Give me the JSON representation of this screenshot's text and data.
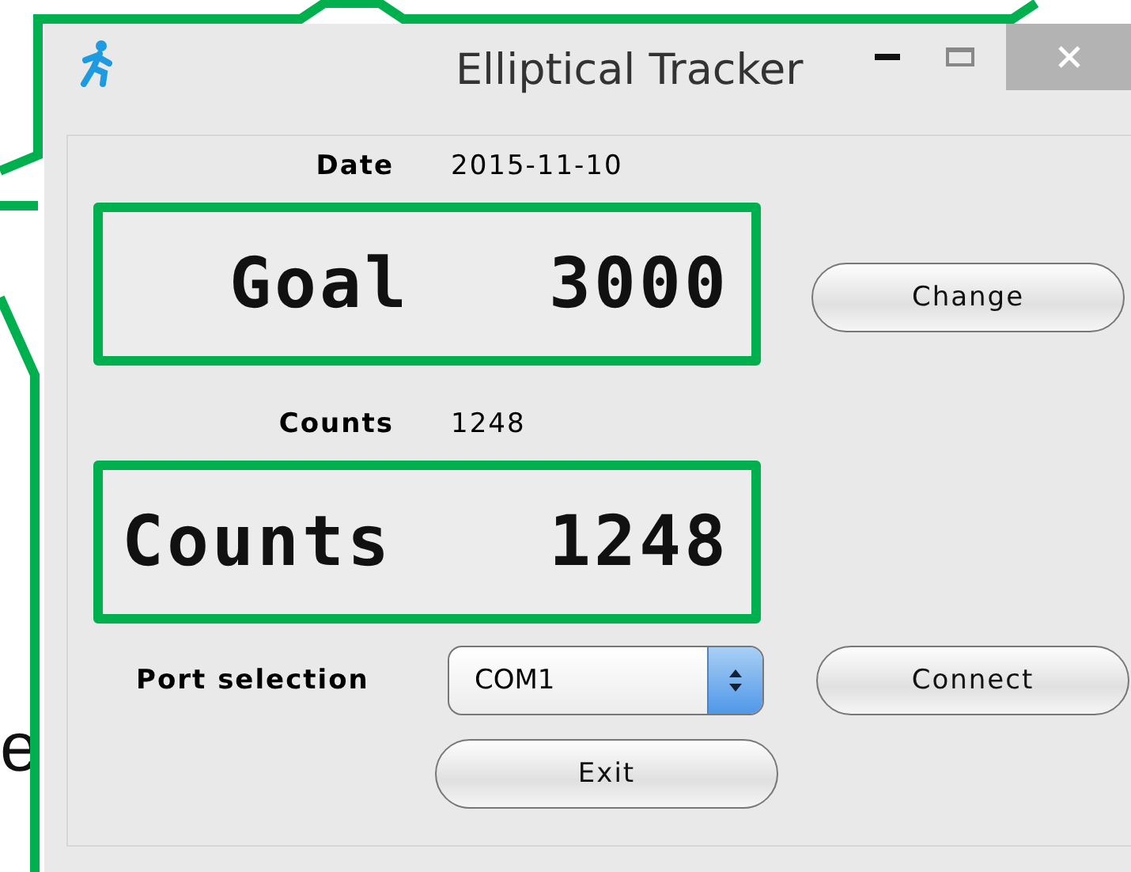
{
  "window": {
    "title": "Elliptical Tracker"
  },
  "date": {
    "label": "Date",
    "value": "2015-11-10"
  },
  "goal_display": {
    "label": "Goal",
    "value": "3000"
  },
  "change_button": "Change",
  "counts": {
    "label": "Counts",
    "value": "1248"
  },
  "counts_display": {
    "label": "Counts",
    "value": "1248"
  },
  "port": {
    "label": "Port selection",
    "value": "COM1"
  },
  "connect_button": "Connect",
  "exit_button": "Exit",
  "background_text": "e"
}
